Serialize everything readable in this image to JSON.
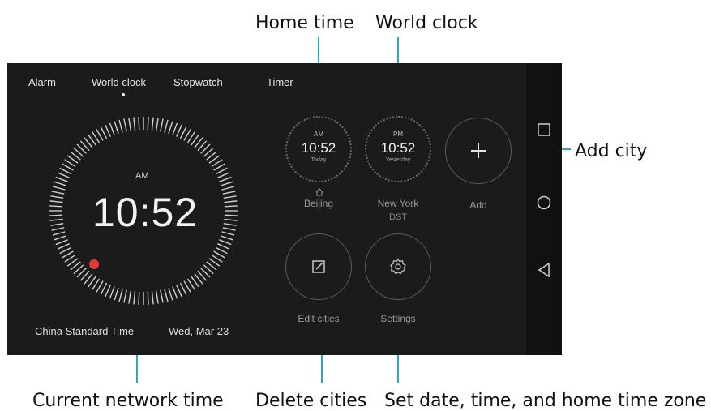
{
  "callouts": {
    "home_time": "Home time",
    "world_clock": "World clock",
    "add_city": "Add city",
    "current_network_time": "Current network time",
    "delete_cities": "Delete cities",
    "set_date_time": "Set date, time, and home time zone"
  },
  "tabs": [
    "Alarm",
    "World clock",
    "Stopwatch",
    "Timer"
  ],
  "selected_tab": "World clock",
  "main_clock": {
    "ampm": "AM",
    "time": "10:52",
    "timezone": "China Standard Time",
    "date": "Wed, Mar 23"
  },
  "cities": [
    {
      "ampm": "AM",
      "time": "10:52",
      "day": "Today",
      "name": "Beijing",
      "sub": "",
      "home": true
    },
    {
      "ampm": "PM",
      "time": "10:52",
      "day": "Yesterday",
      "name": "New York",
      "sub": "DST",
      "home": false
    }
  ],
  "add_button": {
    "label": "Add",
    "icon": "plus-icon"
  },
  "edit_button": {
    "label": "Edit cities",
    "icon": "edit-icon"
  },
  "settings_button": {
    "label": "Settings",
    "icon": "gear-icon"
  },
  "nav_icons": [
    "square-icon",
    "circle-icon",
    "triangle-back-icon"
  ],
  "colors": {
    "accent": "#2aa9b6",
    "screen_bg": "#1b1b1b",
    "red_marker": "#e5383b"
  }
}
